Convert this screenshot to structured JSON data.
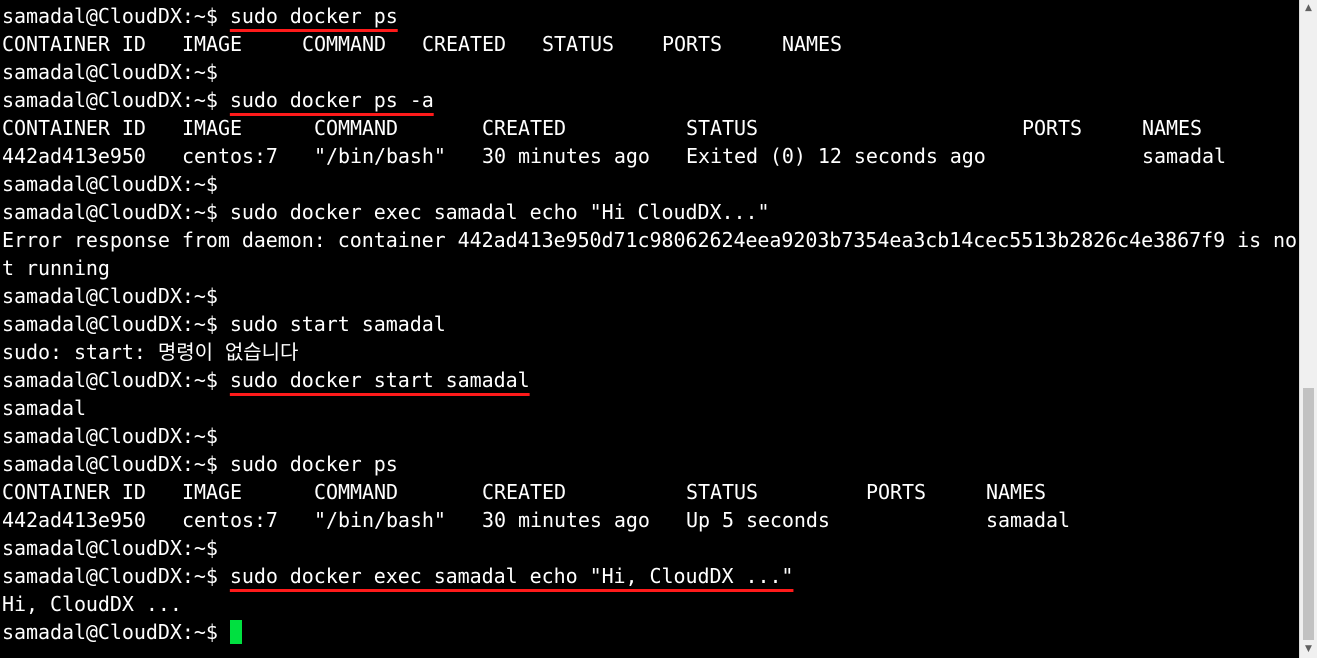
{
  "terminal": {
    "prompt": "samadal@CloudDX:~$ ",
    "cursor_color": "#00e040",
    "highlight_color": "#ff1a1a",
    "lines": [
      {
        "type": "command",
        "cmd": "sudo docker ps",
        "highlight": true
      },
      {
        "type": "table",
        "cells": [
          "CONTAINER ID",
          "IMAGE",
          "COMMAND",
          "CREATED",
          "STATUS",
          "PORTS",
          "NAMES"
        ]
      },
      {
        "type": "command",
        "cmd": "",
        "highlight": false
      },
      {
        "type": "command",
        "cmd": "sudo docker ps -a",
        "highlight": true
      },
      {
        "type": "table",
        "cells": [
          "CONTAINER ID",
          "IMAGE",
          "COMMAND",
          "CREATED",
          "STATUS",
          "PORTS",
          "NAMES"
        ]
      },
      {
        "type": "table",
        "cells": [
          "442ad413e950",
          "centos:7",
          "\"/bin/bash\"",
          "30 minutes ago",
          "Exited (0) 12 seconds ago",
          "",
          "samadal"
        ]
      },
      {
        "type": "command",
        "cmd": "",
        "highlight": false
      },
      {
        "type": "command",
        "cmd": "sudo docker exec samadal echo \"Hi CloudDX...\"",
        "highlight": false
      },
      {
        "type": "output",
        "text": "Error response from daemon: container 442ad413e950d71c98062624eea9203b7354ea3cb14cec5513b2826c4e3867f9 is no"
      },
      {
        "type": "output",
        "text": "t running"
      },
      {
        "type": "command",
        "cmd": "",
        "highlight": false
      },
      {
        "type": "command",
        "cmd": "sudo start samadal",
        "highlight": false
      },
      {
        "type": "output",
        "text": "sudo: start: 명령이 없습니다"
      },
      {
        "type": "command",
        "cmd": "sudo docker start samadal",
        "highlight": true
      },
      {
        "type": "output",
        "text": "samadal"
      },
      {
        "type": "command",
        "cmd": "",
        "highlight": false
      },
      {
        "type": "command",
        "cmd": "sudo docker ps",
        "highlight": false
      },
      {
        "type": "table",
        "cells": [
          "CONTAINER ID",
          "IMAGE",
          "COMMAND",
          "CREATED",
          "STATUS",
          "PORTS",
          "NAMES"
        ]
      },
      {
        "type": "table",
        "cells": [
          "442ad413e950",
          "centos:7",
          "\"/bin/bash\"",
          "30 minutes ago",
          "Up 5 seconds",
          "",
          "samadal"
        ]
      },
      {
        "type": "command",
        "cmd": "",
        "highlight": false
      },
      {
        "type": "command",
        "cmd": "sudo docker exec samadal echo \"Hi, CloudDX ...\"",
        "highlight": true
      },
      {
        "type": "output",
        "text": "Hi, CloudDX ..."
      },
      {
        "type": "command",
        "cmd": "",
        "highlight": false,
        "cursor": true
      }
    ]
  },
  "scrollbar": {
    "up_arrow_icon": "triangle-up",
    "down_arrow_icon": "triangle-down"
  }
}
